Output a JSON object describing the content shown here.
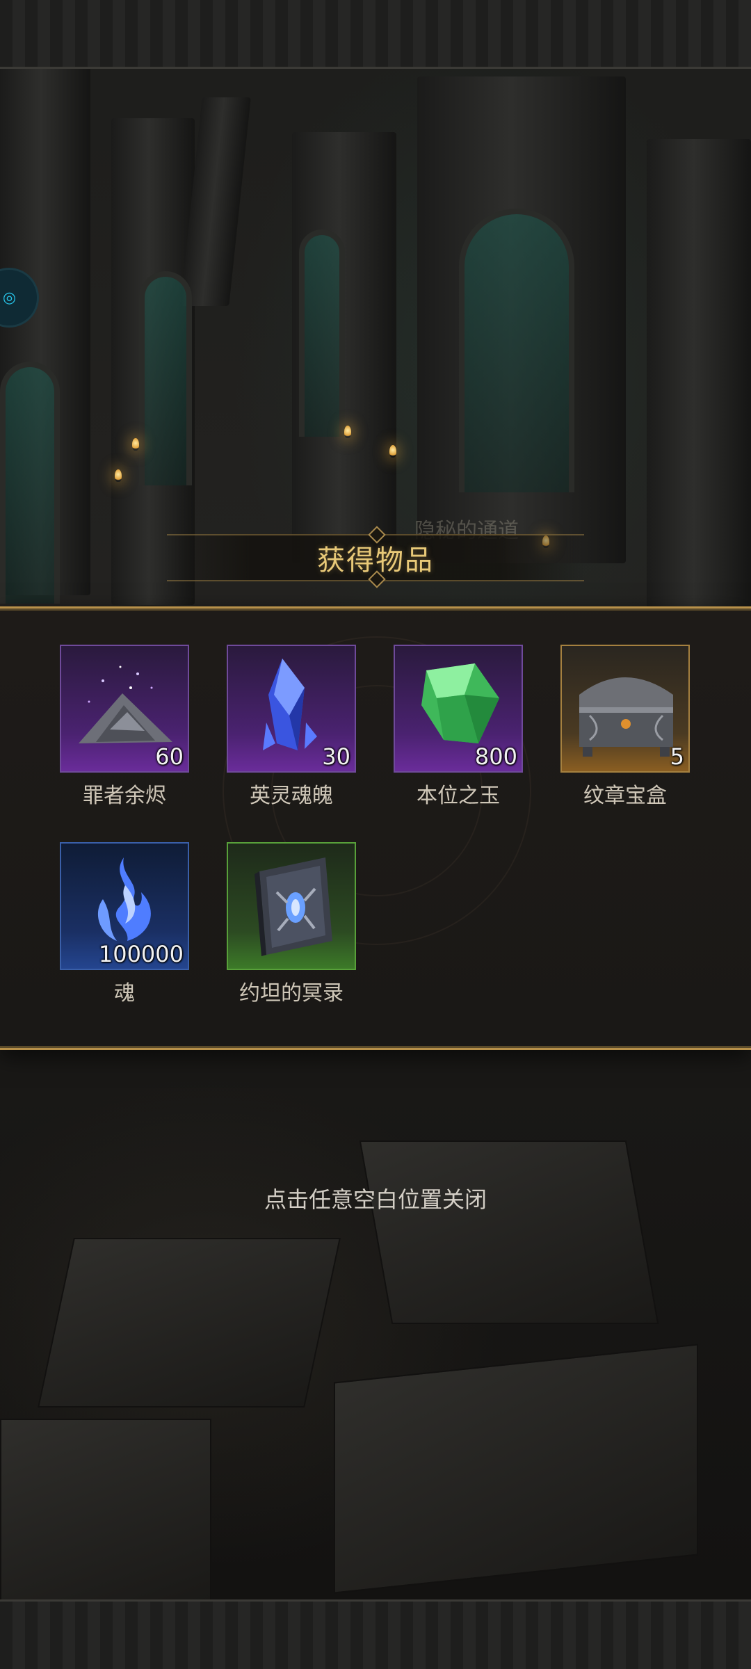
{
  "dialog": {
    "title": "获得物品",
    "background_label": "隐秘的通道",
    "close_hint": "点击任意空白位置关闭"
  },
  "items": [
    {
      "name": "罪者余烬",
      "quantity": "60",
      "icon": "ember-pile-icon",
      "rarity_color": "#6a2c9a"
    },
    {
      "name": "英灵魂魄",
      "quantity": "30",
      "icon": "blue-crystal-icon",
      "rarity_color": "#6a2c9a"
    },
    {
      "name": "本位之玉",
      "quantity": "800",
      "icon": "green-gem-icon",
      "rarity_color": "#6a2c9a"
    },
    {
      "name": "纹章宝盒",
      "quantity": "5",
      "icon": "treasure-chest-icon",
      "rarity_color": "#8a5e22"
    },
    {
      "name": "魂",
      "quantity": "100000",
      "icon": "blue-soul-flame-icon",
      "rarity_color": "#24458f"
    },
    {
      "name": "约坦的冥录",
      "quantity": "",
      "icon": "dark-tome-icon",
      "rarity_color": "#3c7a28"
    }
  ],
  "colors": {
    "accent_gold": "#e8c978",
    "panel_border": "#b8914a",
    "purple_rarity": "#6a2c9a",
    "gold_rarity": "#8a5e22",
    "blue_rarity": "#24458f",
    "green_rarity": "#3c7a28"
  }
}
